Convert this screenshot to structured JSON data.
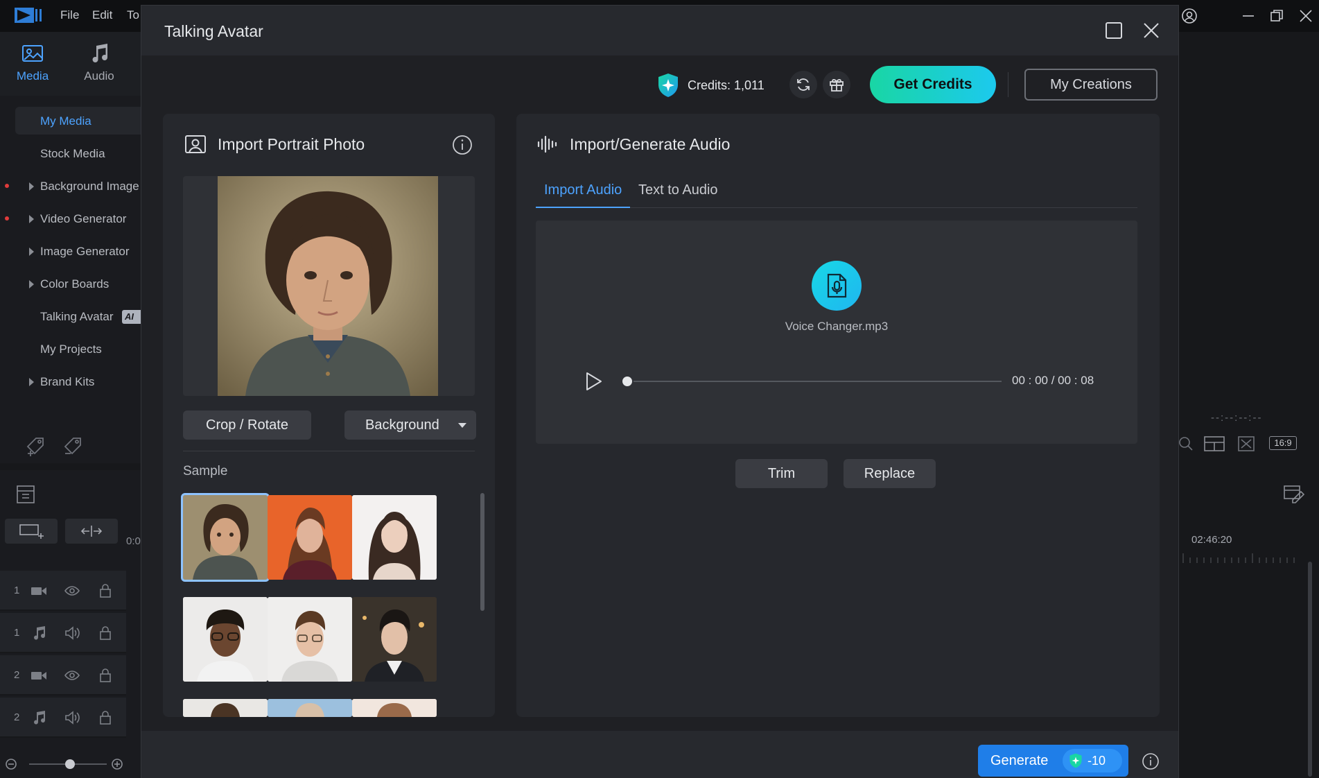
{
  "app": {
    "menu": [
      "File",
      "Edit",
      "To"
    ],
    "left_tabs": [
      {
        "label": "Media",
        "icon": "media-icon",
        "active": true
      },
      {
        "label": "Audio",
        "icon": "music-note-icon",
        "active": false
      }
    ],
    "sidebar": {
      "items": [
        {
          "label": "My Media",
          "active": true
        },
        {
          "label": "Stock Media"
        },
        {
          "label": "Background Image"
        },
        {
          "label": "Video Generator"
        },
        {
          "label": "Image Generator"
        },
        {
          "label": "Color Boards"
        },
        {
          "label": "Talking Avatar",
          "badge": "AI"
        },
        {
          "label": "My Projects"
        },
        {
          "label": "Brand Kits"
        }
      ]
    },
    "timeline": {
      "tracks": [
        "1",
        "1",
        "2",
        "2"
      ],
      "time_left": "0:0",
      "time_right": "02:46:20",
      "timecode": "--:--:--:--",
      "aspect": "16:9"
    }
  },
  "modal": {
    "title": "Talking Avatar",
    "credits_label": "Credits: 1,011",
    "get_credits_label": "Get Credits",
    "my_creations_label": "My Creations",
    "portrait": {
      "title": "Import Portrait Photo",
      "crop_label": "Crop / Rotate",
      "background_label": "Background",
      "sample_label": "Sample"
    },
    "audio": {
      "title": "Import/Generate Audio",
      "tabs": [
        {
          "label": "Import Audio",
          "active": true
        },
        {
          "label": "Text to Audio",
          "active": false
        }
      ],
      "file_name": "Voice Changer.mp3",
      "time": "00 : 00 / 00 : 08",
      "progress": 0,
      "trim_label": "Trim",
      "replace_label": "Replace"
    },
    "generate_label": "Generate",
    "generate_cost": "-10"
  },
  "colors": {
    "accent": "#4da3ff",
    "credits_gradient_start": "#19d6a4",
    "credits_gradient_end": "#1cc9ee",
    "generate": "#1f7ee8"
  }
}
